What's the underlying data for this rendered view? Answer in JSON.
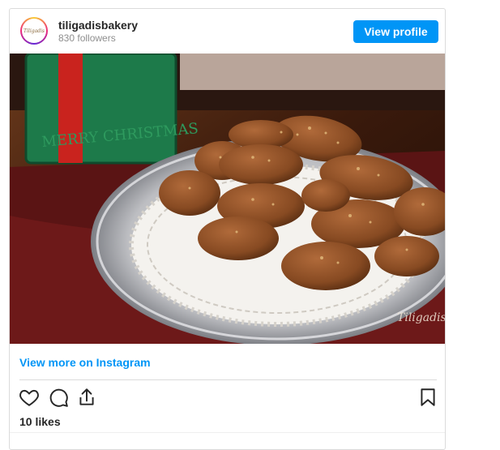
{
  "profile": {
    "username": "tiligadisbakery",
    "followers": "830 followers",
    "avatar_text": "Tiligadis",
    "view_profile_label": "View profile"
  },
  "post": {
    "image_alt": "Plate of melomakarona Christmas honey cookies",
    "watermark": "Tiligadis",
    "view_more_label": "View more on Instagram",
    "likes": "10 likes"
  },
  "icons": {
    "like": "heart-icon",
    "comment": "comment-icon",
    "share": "share-icon",
    "save": "bookmark-icon"
  },
  "colors": {
    "accent": "#0095f6",
    "text": "#262626",
    "muted": "#8e8e8e"
  }
}
